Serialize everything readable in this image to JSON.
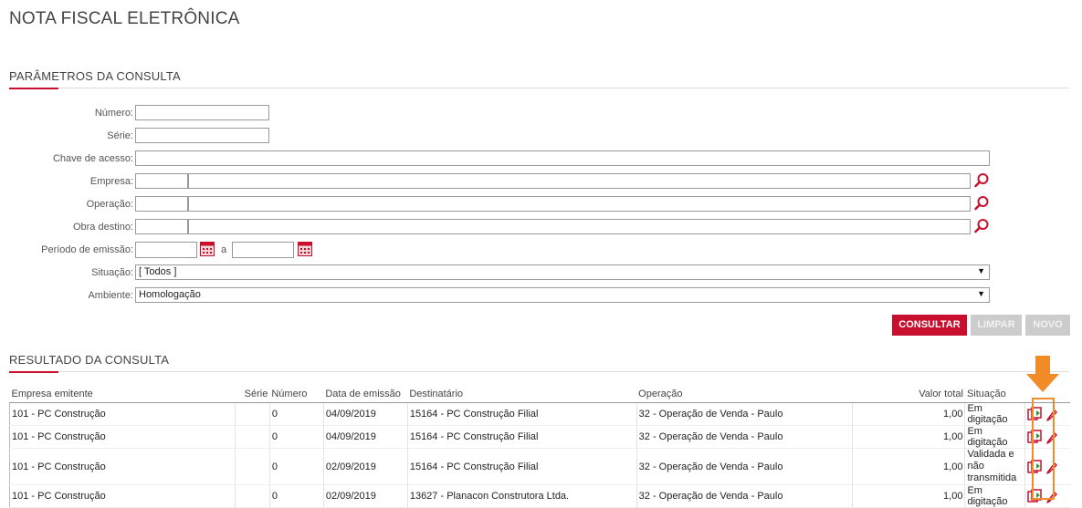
{
  "page": {
    "title": "NOTA FISCAL ELETRÔNICA"
  },
  "params": {
    "section_title": "PARÂMETROS DA CONSULTA",
    "numero_label": "Número:",
    "serie_label": "Série:",
    "chave_label": "Chave de acesso:",
    "empresa_label": "Empresa:",
    "operacao_label": "Operação:",
    "obra_label": "Obra destino:",
    "periodo_label": "Período de emissão:",
    "periodo_sep": "a",
    "situacao_label": "Situação:",
    "situacao_value": "[ Todos ]",
    "ambiente_label": "Ambiente:",
    "ambiente_value": "Homologação"
  },
  "buttons": {
    "consultar": "CONSULTAR",
    "limpar": "LIMPAR",
    "novo": "NOVO"
  },
  "results": {
    "section_title": "RESULTADO DA CONSULTA",
    "columns": {
      "empresa": "Empresa emitente",
      "serie": "Série",
      "numero": "Número",
      "data": "Data de emissão",
      "destinatario": "Destinatário",
      "operacao": "Operação",
      "valor": "Valor total",
      "situacao": "Situação"
    },
    "rows": [
      {
        "empresa": "101 - PC Construção",
        "serie": "",
        "numero": "0",
        "data": "04/09/2019",
        "destinatario": "15164 - PC Construção Filial",
        "operacao": "32 - Operação de Venda - Paulo",
        "valor": "1,00",
        "situacao": "Em digitação"
      },
      {
        "empresa": "101 - PC Construção",
        "serie": "",
        "numero": "0",
        "data": "04/09/2019",
        "destinatario": "15164 - PC Construção Filial",
        "operacao": "32 - Operação de Venda - Paulo",
        "valor": "1,00",
        "situacao": "Em digitação"
      },
      {
        "empresa": "101 - PC Construção",
        "serie": "",
        "numero": "0",
        "data": "02/09/2019",
        "destinatario": "15164 - PC Construção Filial",
        "operacao": "32 - Operação de Venda - Paulo",
        "valor": "1,00",
        "situacao": "Validada e não transmitida"
      },
      {
        "empresa": "101 - PC Construção",
        "serie": "",
        "numero": "0",
        "data": "02/09/2019",
        "destinatario": "13627 - Planacon Construtora Ltda.",
        "operacao": "32 - Operação de Venda - Paulo",
        "valor": "1,00",
        "situacao": "Em digitação"
      }
    ]
  },
  "colors": {
    "accent": "#c8102e",
    "highlight": "#f28c28",
    "disabled": "#cccccc"
  },
  "icons": [
    "search-icon",
    "calendar-icon",
    "copy-icon",
    "edit-icon",
    "arrow-down-icon"
  ]
}
